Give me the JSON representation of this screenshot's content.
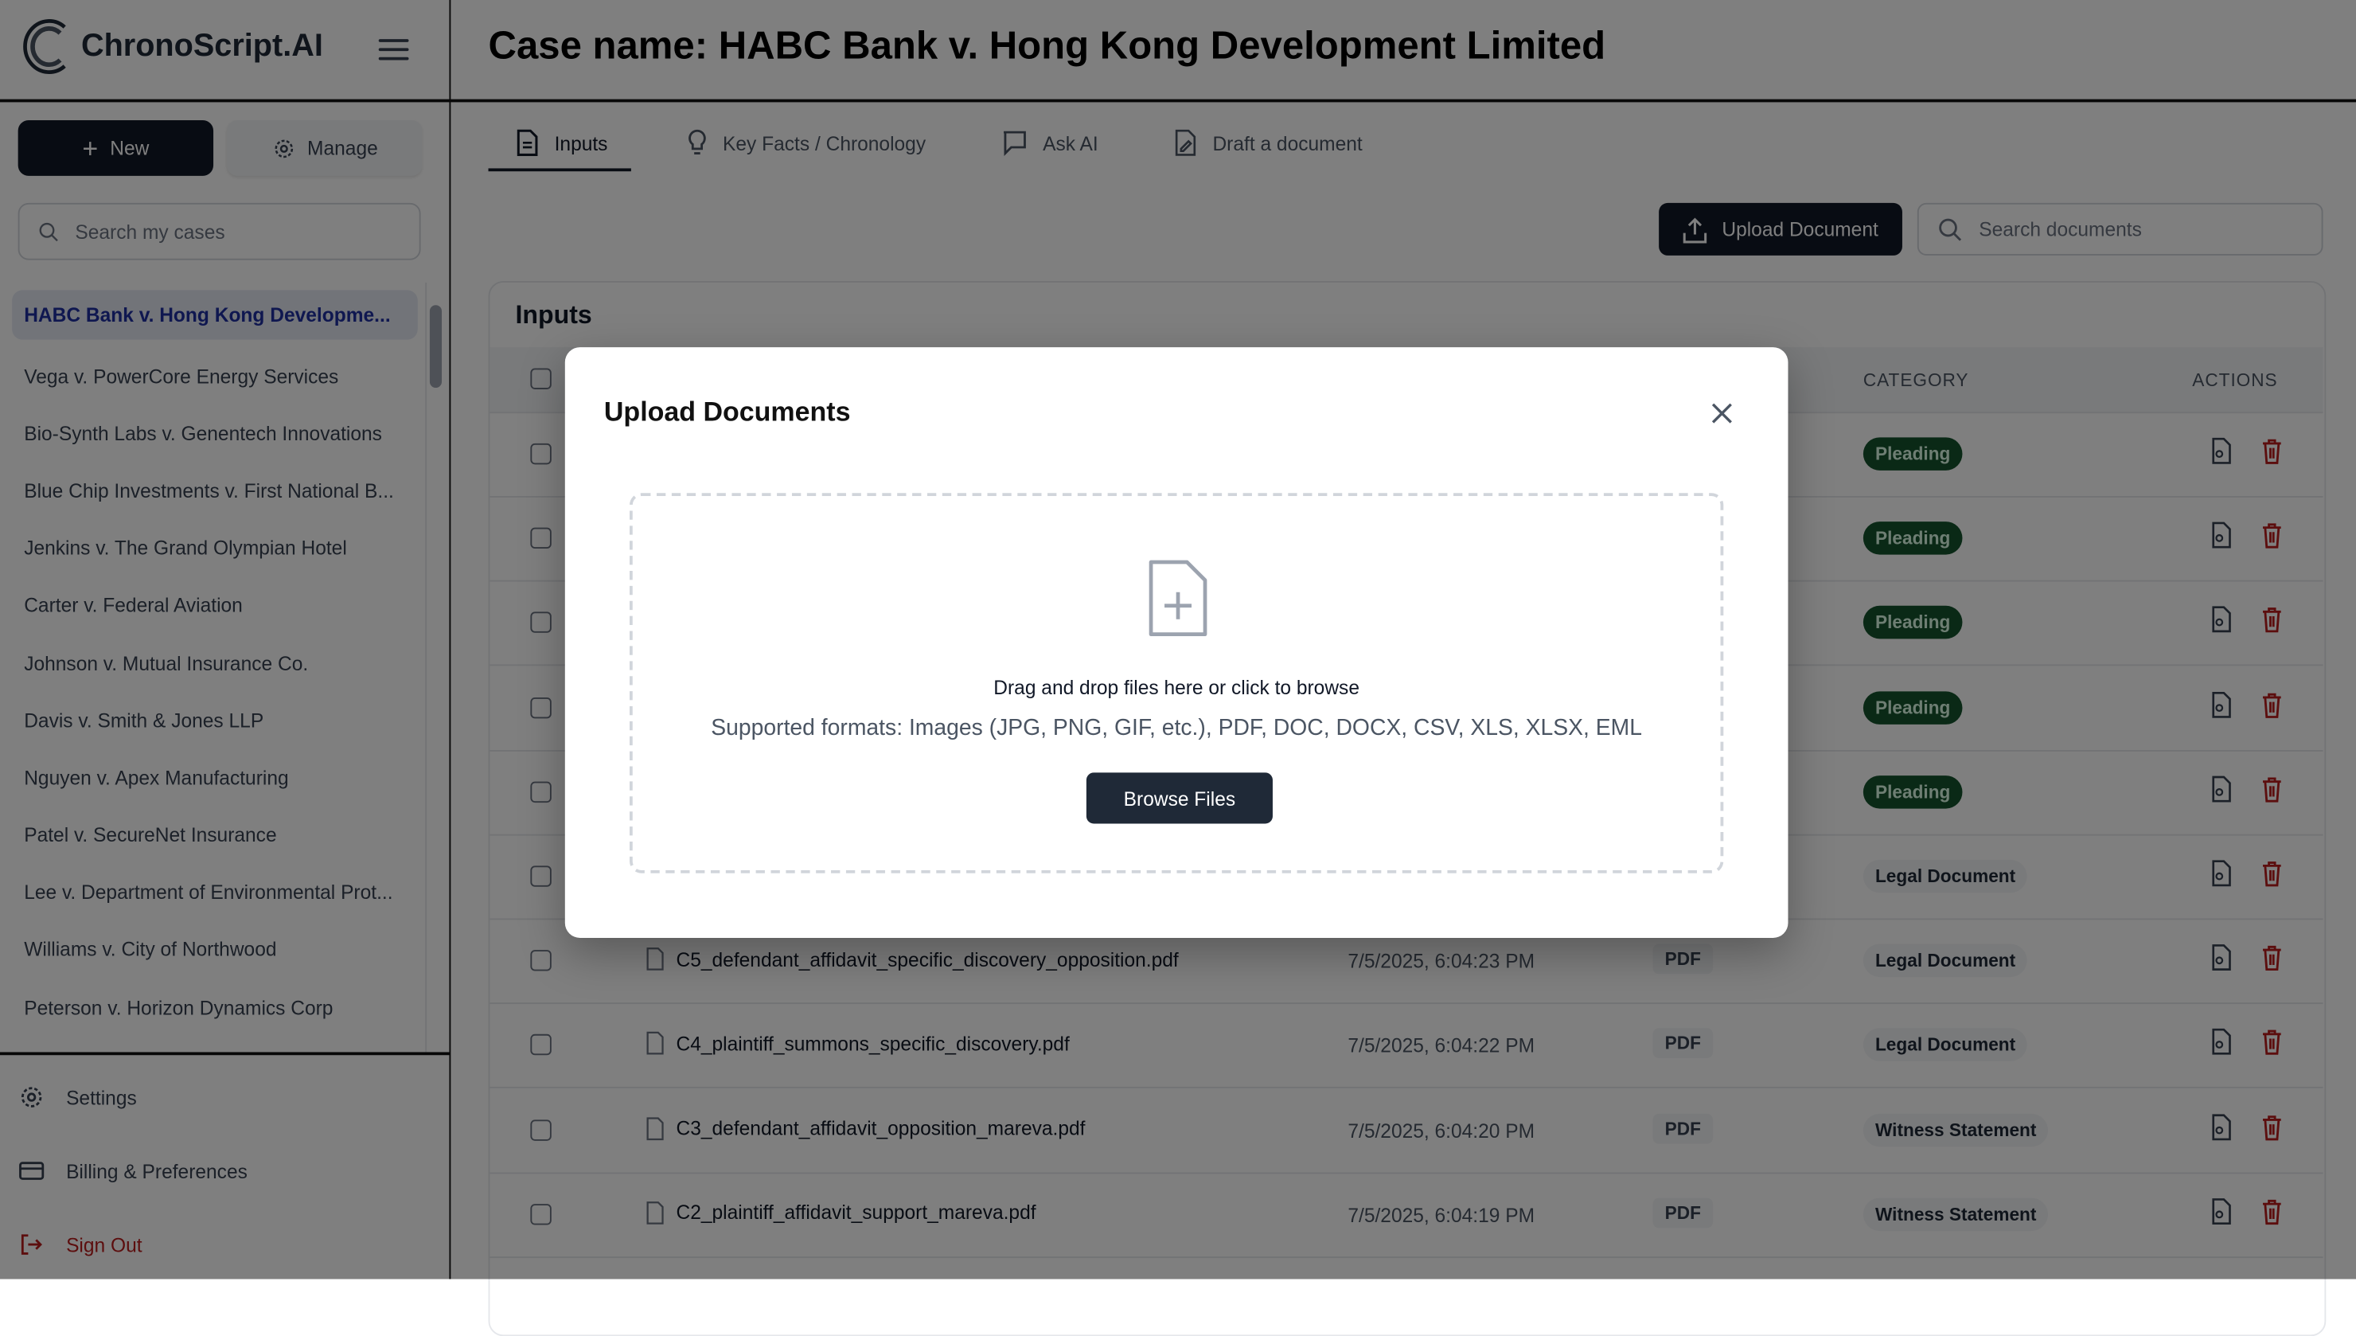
{
  "app": {
    "name": "ChronoScript.AI"
  },
  "sidebar": {
    "new_label": "New",
    "manage_label": "Manage",
    "search_placeholder": "Search my cases",
    "cases": [
      "HABC Bank v. Hong Kong Developme...",
      "Vega v. PowerCore Energy Services",
      "Bio-Synth Labs v. Genentech Innovations",
      "Blue Chip Investments v. First National B...",
      "Jenkins v. The Grand Olympian Hotel",
      "Carter v. Federal Aviation",
      "Johnson v. Mutual Insurance Co.",
      "Davis v. Smith & Jones LLP",
      "Nguyen v. Apex Manufacturing",
      "Patel v. SecureNet Insurance",
      "Lee v. Department of Environmental Prot...",
      "Williams v. City of Northwood",
      "Peterson v. Horizon Dynamics Corp"
    ],
    "settings_label": "Settings",
    "billing_label": "Billing & Preferences",
    "signout_label": "Sign Out"
  },
  "header": {
    "title": "Case name: HABC Bank v. Hong Kong Development Limited"
  },
  "tabs": [
    {
      "label": "Inputs",
      "active": true
    },
    {
      "label": "Key Facts / Chronology"
    },
    {
      "label": "Ask AI"
    },
    {
      "label": "Draft a document"
    }
  ],
  "toolbar": {
    "upload_label": "Upload Document",
    "search_placeholder": "Search documents"
  },
  "inputs": {
    "title": "Inputs",
    "columns": {
      "category": "CATEGORY",
      "actions": "ACTIONS"
    },
    "rows": [
      {
        "category": "Pleading"
      },
      {
        "category": "Pleading"
      },
      {
        "category": "Pleading"
      },
      {
        "category": "Pleading"
      },
      {
        "category": "Pleading"
      },
      {
        "category": "Legal Document"
      },
      {
        "file": "C5_defendant_affidavit_specific_discovery_opposition.pdf",
        "date": "7/5/2025, 6:04:23 PM",
        "type": "PDF",
        "category": "Legal Document"
      },
      {
        "file": "C4_plaintiff_summons_specific_discovery.pdf",
        "date": "7/5/2025, 6:04:22 PM",
        "type": "PDF",
        "category": "Legal Document"
      },
      {
        "file": "C3_defendant_affidavit_opposition_mareva.pdf",
        "date": "7/5/2025, 6:04:20 PM",
        "type": "PDF",
        "category": "Witness Statement"
      },
      {
        "file": "C2_plaintiff_affidavit_support_mareva.pdf",
        "date": "7/5/2025, 6:04:19 PM",
        "type": "PDF",
        "category": "Witness Statement"
      }
    ]
  },
  "modal": {
    "title": "Upload Documents",
    "drop_text": "Drag and drop files here or click to browse",
    "formats": "Supported formats: Images (JPG, PNG, GIF, etc.), PDF, DOC, DOCX, CSV, XLS, XLSX, EML",
    "browse_label": "Browse Files"
  },
  "colors": {
    "primary": "#111827",
    "pleading": "#14532d",
    "delete": "#b91c1c",
    "active_case": "#1e2fa0"
  }
}
